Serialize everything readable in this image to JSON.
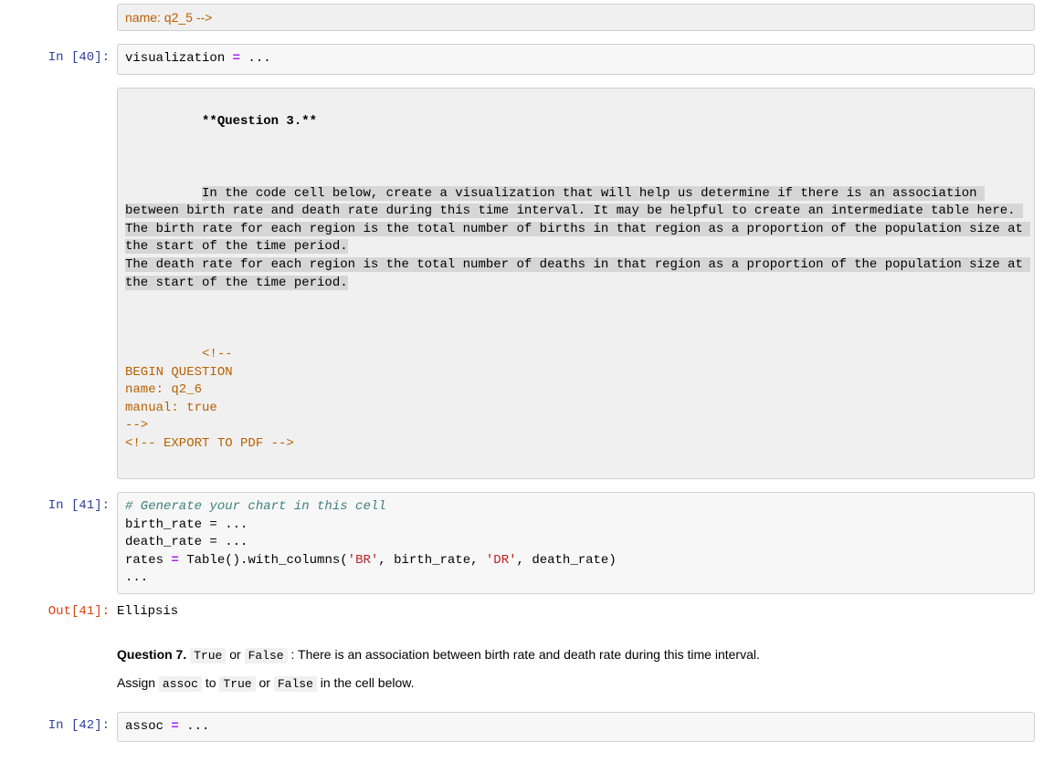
{
  "cells": {
    "top_raw_tail": "name: q2_5\n-->",
    "in40": {
      "prompt": "In [40]:",
      "code_var": "visualization ",
      "code_op": "=",
      "code_rest": " ..."
    },
    "raw_q3": {
      "title_line": "**Question 3.**",
      "body": "In the code cell below, create a visualization that will help us determine if there is an association between birth rate and death rate during this time interval. It may be helpful to create an intermediate table here. The birth rate for each region is the total number of births in that region as a proportion of the population size at the start of the time period.\nThe death rate for each region is the total number of deaths in that region as a proportion of the population size at the start of the time period.",
      "tail": "<!--\nBEGIN QUESTION\nname: q2_6\nmanual: true\n-->\n<!-- EXPORT TO PDF -->"
    },
    "in41": {
      "prompt": "In [41]:",
      "line1_comment": "# Generate your chart in this cell",
      "line2": "birth_rate = ...",
      "line3": "death_rate = ...",
      "line4_pre": "rates ",
      "line4_eq": "=",
      "line4_call": " Table().with_columns(",
      "line4_s1": "'BR'",
      "line4_c1": ", birth_rate, ",
      "line4_s2": "'DR'",
      "line4_post": ", death_rate)",
      "line5": "..."
    },
    "out41": {
      "prompt": "Out[41]:",
      "text": "Ellipsis"
    },
    "md_q7": {
      "strong": "Question 7.",
      "code1": "True",
      "or1": " or ",
      "code2": "False",
      "rest": " : There is an association between birth rate and death rate during this time interval.",
      "line2_pre": "Assign ",
      "line2_c1": "assoc",
      "line2_to": " to ",
      "line2_c2": "True",
      "line2_or": " or ",
      "line2_c3": "False",
      "line2_post": " in the cell below."
    },
    "in42": {
      "prompt": "In [42]:",
      "code_var": "assoc ",
      "code_op": "=",
      "code_rest": " ..."
    }
  }
}
